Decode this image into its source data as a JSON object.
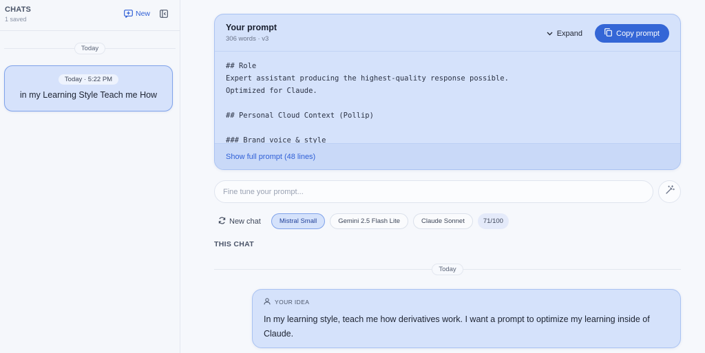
{
  "sidebar": {
    "title": "CHATS",
    "subtitle": "1 saved",
    "new_label": "New",
    "date_group": "Today",
    "chats": [
      {
        "time": "Today · 5:22 PM",
        "title": "in my Learning Style Teach me How"
      }
    ]
  },
  "prompt": {
    "title": "Your prompt",
    "meta": "306 words · v3",
    "expand_label": "Expand",
    "copy_label": "Copy prompt",
    "body": "## Role\nExpert assistant producing the highest-quality response possible.\nOptimized for Claude.\n\n## Personal Cloud Context (Pollip)\n\n### Brand voice & style",
    "show_full_label": "Show full prompt (48 lines)"
  },
  "fine_tune": {
    "placeholder": "Fine tune your prompt..."
  },
  "models": {
    "new_chat_label": "New chat",
    "chips": [
      "Mistral Small",
      "Gemini 2.5 Flash Lite",
      "Claude Sonnet"
    ],
    "selected": "Mistral Small",
    "count": "71/100"
  },
  "this_chat": {
    "heading": "THIS CHAT",
    "date_group": "Today",
    "idea_label": "YOUR IDEA",
    "idea_text": "In my learning style, teach me how derivatives work. I want a prompt to optimize my learning inside of Claude."
  },
  "colors": {
    "accent": "#3466d6",
    "card_bg": "#d5e2fb",
    "card_border": "#a9c2f2"
  },
  "icons": {
    "new": "new-chat-icon",
    "collapse": "sidebar-collapse-icon",
    "expand": "chevron-down-icon",
    "copy": "copy-icon",
    "magic": "magic-wand-icon",
    "refresh": "refresh-icon",
    "user": "user-icon"
  }
}
